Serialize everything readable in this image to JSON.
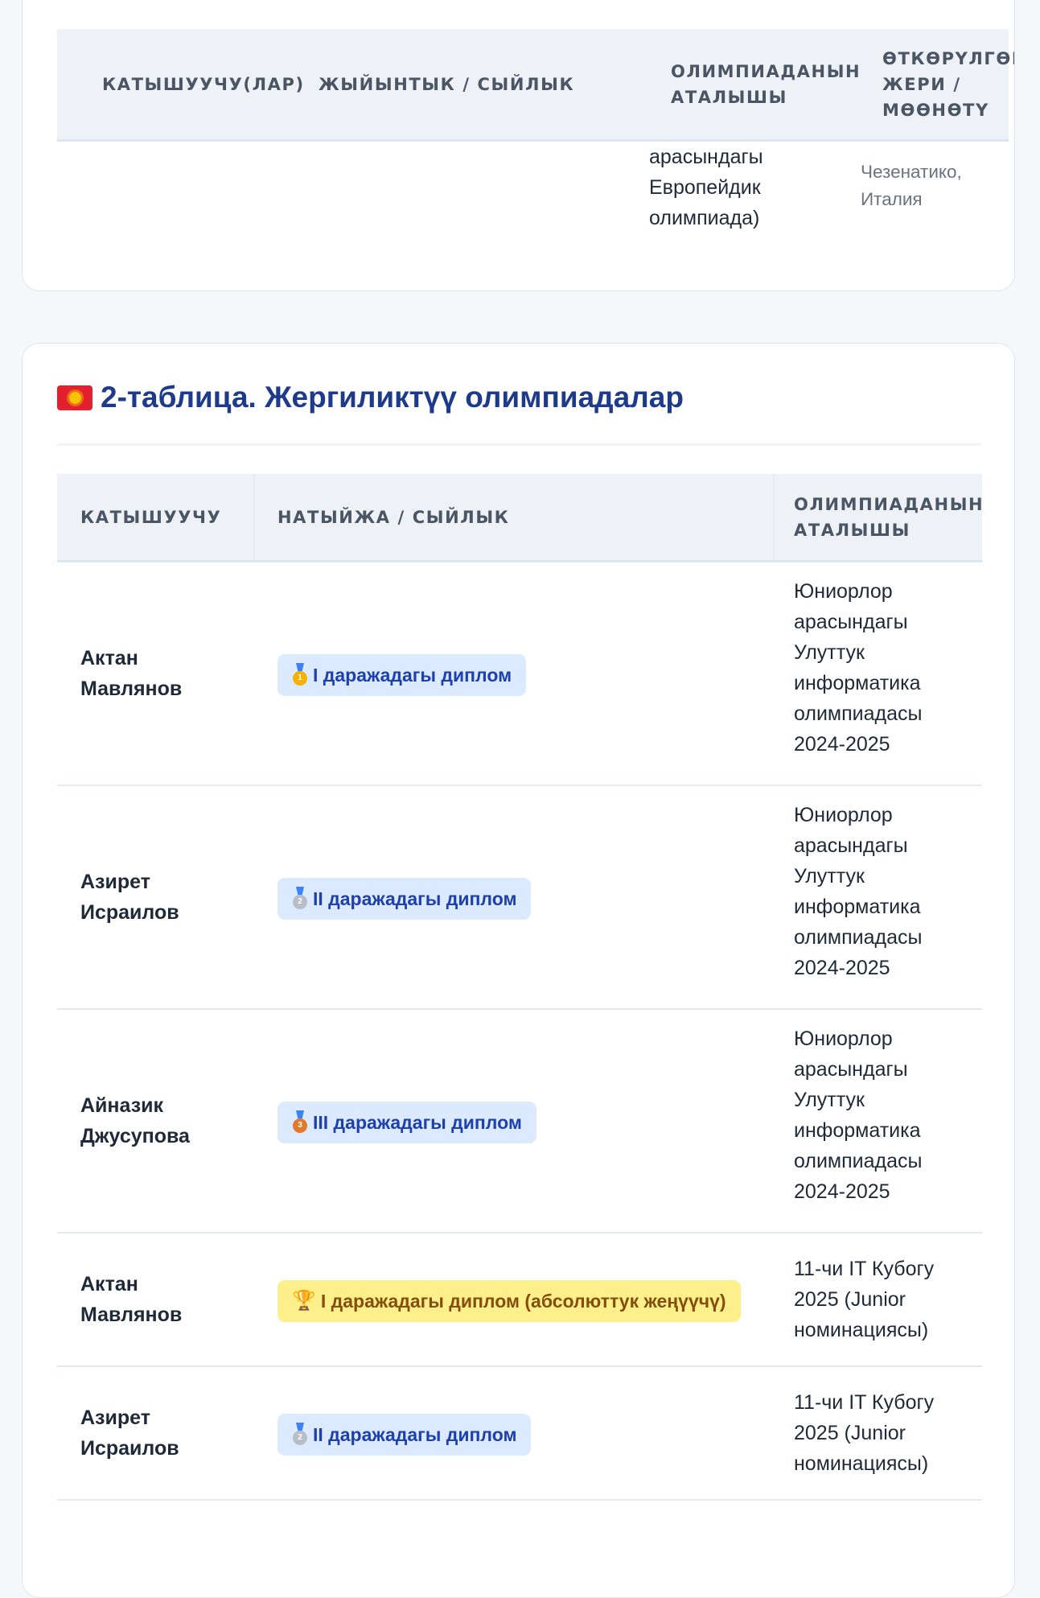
{
  "table1": {
    "headers": {
      "participants": "КАТЫШУУЧУ(ЛАР)",
      "result": "ЖЫЙЫНТЫК / СЫЙЛЫК",
      "olympiad": "ОЛИМПИАДАНЫН АТАЛЫШЫ",
      "place": "ӨТКӨРҮЛГӨН ЖЕРИ / МӨӨНӨТҮ"
    },
    "partial_row": {
      "olympiad_lines": [
        "арасындагы",
        "Европейдик",
        "олимпиада)"
      ],
      "place_lines": [
        "Чезенатико,",
        "Италия"
      ]
    }
  },
  "table2": {
    "title": "2-таблица. Жергиликтүү олимпиадалар",
    "flag_icon": "kyrgyzstan-flag-icon",
    "headers": {
      "participant": "КАТЫШУУЧУ",
      "result": "НАТЫЙЖА / СЫЙЛЫК",
      "olympiad": "ОЛИМПИАДАНЫН АТАЛЫШЫ"
    },
    "rows": [
      {
        "name_lines": [
          "Актан",
          "Мавлянов"
        ],
        "award": "I даражадагы диплом",
        "award_icon": "gold-medal-icon",
        "medal_digit": "1",
        "olympiad_lines": [
          "Юниорлор",
          "арасындагы",
          "Улуттук",
          "информатика",
          "олимпиадасы",
          "2024-2025"
        ]
      },
      {
        "name_lines": [
          "Азирет",
          "Исраилов"
        ],
        "award": "II даражадагы диплом",
        "award_icon": "silver-medal-icon",
        "medal_digit": "2",
        "olympiad_lines": [
          "Юниорлор",
          "арасындагы",
          "Улуттук",
          "информатика",
          "олимпиадасы",
          "2024-2025"
        ]
      },
      {
        "name_lines": [
          "Айназик",
          "Джусупова"
        ],
        "award": "III даражадагы диплом",
        "award_icon": "bronze-medal-icon",
        "medal_digit": "3",
        "olympiad_lines": [
          "Юниорлор",
          "арасындагы",
          "Улуттук",
          "информатика",
          "олимпиадасы",
          "2024-2025"
        ]
      },
      {
        "name_lines": [
          "Актан",
          "Мавлянов"
        ],
        "award": "I даражадагы диплом (абсолюттук жеңүүчү)",
        "award_icon": "trophy-icon",
        "olympiad_lines": [
          "11-чи IT Кубогу",
          "2025 (Junior",
          "номинациясы)"
        ]
      },
      {
        "name_lines": [
          "Азирет",
          "Исраилов"
        ],
        "award": "II даражадагы диплом",
        "award_icon": "silver-medal-icon",
        "medal_digit": "2",
        "olympiad_lines": [
          "11-чи IT Кубогу",
          "2025 (Junior",
          "номинациясы)"
        ]
      }
    ]
  },
  "colors": {
    "title": "#1e3a8a",
    "badge_blue_bg": "#dbeafe",
    "badge_blue_text": "#1e40af",
    "badge_gold_bg": "#fdf08a",
    "badge_gold_text": "#854d0e",
    "header_bg": "#eef2f7"
  }
}
